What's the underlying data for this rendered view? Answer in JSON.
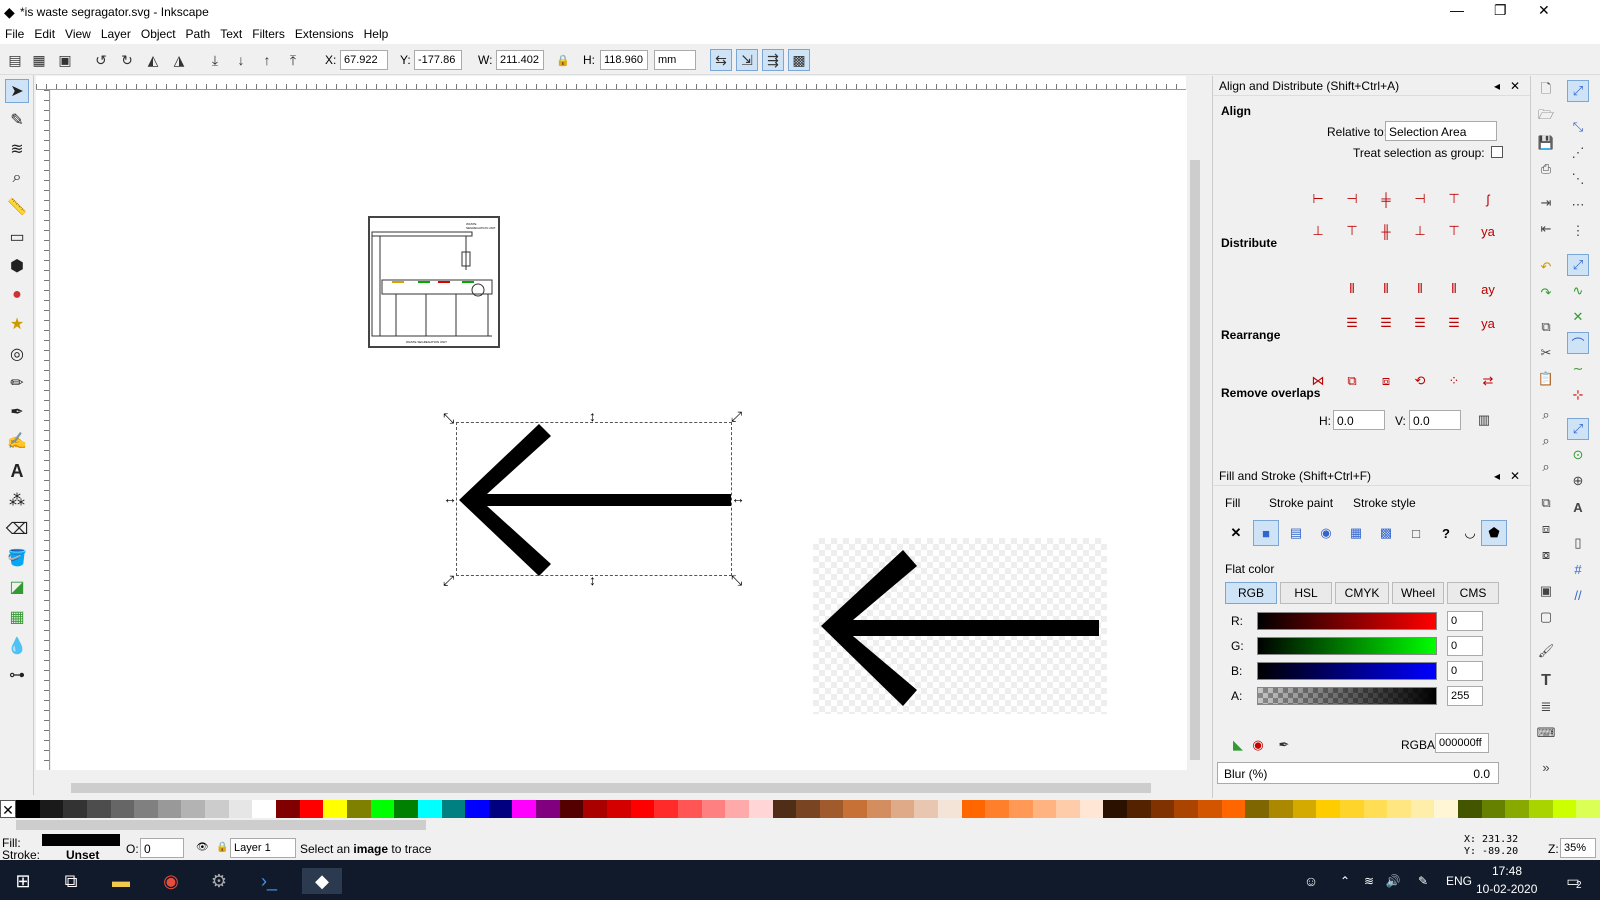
{
  "window": {
    "title": "*is waste segragator.svg - Inkscape",
    "minimize": "—",
    "maximize": "❐",
    "close": "✕"
  },
  "menu": [
    "File",
    "Edit",
    "View",
    "Layer",
    "Object",
    "Path",
    "Text",
    "Filters",
    "Extensions",
    "Help"
  ],
  "toolbar": {
    "x_label": "X:",
    "x_value": "67.922",
    "y_label": "Y:",
    "y_value": "-177.86",
    "w_label": "W:",
    "w_value": "211.402",
    "h_label": "H:",
    "h_value": "118.960",
    "unit": "mm"
  },
  "align_panel": {
    "title": "Align and Distribute (Shift+Ctrl+A)",
    "align_heading": "Align",
    "relative_to_label": "Relative to:",
    "relative_to_value": "Selection Area",
    "treat_group_label": "Treat selection as group:",
    "distribute_heading": "Distribute",
    "rearrange_heading": "Rearrange",
    "remove_overlaps_heading": "Remove overlaps",
    "h_label": "H:",
    "h_value": "0.0",
    "v_label": "V:",
    "v_value": "0.0"
  },
  "fill_panel": {
    "title": "Fill and Stroke (Shift+Ctrl+F)",
    "tab_fill": "Fill",
    "tab_stroke_paint": "Stroke paint",
    "tab_stroke_style": "Stroke style",
    "flat_color": "Flat color",
    "modes": [
      "RGB",
      "HSL",
      "CMYK",
      "Wheel",
      "CMS"
    ],
    "r_label": "R:",
    "r_value": "0",
    "g_label": "G:",
    "g_value": "0",
    "b_label": "B:",
    "b_value": "0",
    "a_label": "A:",
    "a_value": "255",
    "rgba_label": "RGBA:",
    "rgba_value": "000000ff",
    "blur_label": "Blur (%)",
    "blur_value": "0.0"
  },
  "status": {
    "fill_label": "Fill:",
    "stroke_label": "Stroke:",
    "stroke_value": "Unset",
    "opacity_label": "O:",
    "opacity_value": "0",
    "layer": "Layer 1",
    "message_pre": "Select an ",
    "message_bold": "image",
    "message_post": " to trace",
    "cursor_x": "X:  231.32",
    "cursor_y": "Y:  -89.20",
    "zoom_label": "Z:",
    "zoom_value": "35%"
  },
  "taskbar": {
    "lang": "ENG",
    "time": "17:48",
    "date": "10-02-2020",
    "notif": "2"
  },
  "drawing": {
    "frame_title": "WASTE SEGREGATION UNIT",
    "frame_caption": "WASTE SEGREGATION UNIT"
  },
  "colors": {
    "accent": "#3c7fd1",
    "fill": "#000000",
    "palette": [
      "#000000",
      "#1a1a1a",
      "#333333",
      "#4d4d4d",
      "#666666",
      "#808080",
      "#999999",
      "#b3b3b3",
      "#cccccc",
      "#e6e6e6",
      "#ffffff",
      "#800000",
      "#ff0000",
      "#ffff00",
      "#808000",
      "#00ff00",
      "#008000",
      "#00ffff",
      "#008080",
      "#0000ff",
      "#000080",
      "#ff00ff",
      "#800080",
      "#550000",
      "#aa0000",
      "#d40000",
      "#ff0000",
      "#ff2a2a",
      "#ff5555",
      "#ff8080",
      "#ffaaaa",
      "#ffd5d5",
      "#502d16",
      "#784421",
      "#a05a2c",
      "#c87137",
      "#d38d5f",
      "#deaa87",
      "#e9c6af",
      "#f4e3d7",
      "#ff6600",
      "#ff7f2a",
      "#ff9955",
      "#ffb380",
      "#ffccaa",
      "#ffe6d5",
      "#2b1100",
      "#552200",
      "#803300",
      "#aa4400",
      "#d45500",
      "#ff6600",
      "#806600",
      "#aa8800",
      "#d4aa00",
      "#ffcc00",
      "#ffd42a",
      "#ffdd55",
      "#ffe680",
      "#ffeeaa",
      "#fff6d5",
      "#445500",
      "#668000",
      "#88aa00",
      "#aad400",
      "#ccff00",
      "#dcff55"
    ]
  }
}
